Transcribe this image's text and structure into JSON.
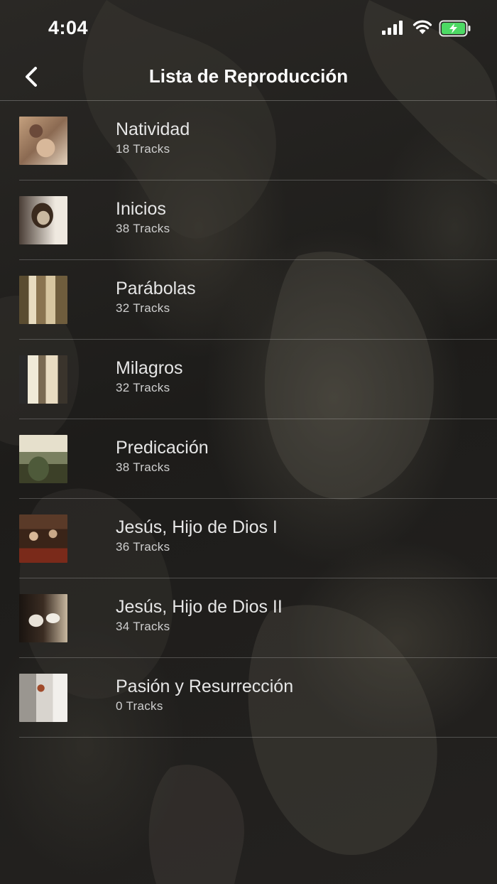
{
  "status_bar": {
    "time": "4:04",
    "icons": [
      "signal-icon",
      "wifi-icon",
      "battery-charging-icon"
    ],
    "battery_color": "#4cd964"
  },
  "nav": {
    "title": "Lista de Reproducción",
    "back_icon": "chevron-left-icon"
  },
  "playlists": [
    {
      "title": "Natividad",
      "tracks": "18 Tracks"
    },
    {
      "title": "Inicios",
      "tracks": "38 Tracks"
    },
    {
      "title": "Parábolas",
      "tracks": "32 Tracks"
    },
    {
      "title": "Milagros",
      "tracks": "32 Tracks"
    },
    {
      "title": "Predicación",
      "tracks": "38 Tracks"
    },
    {
      "title": "Jesús, Hijo de Dios I",
      "tracks": "36 Tracks"
    },
    {
      "title": "Jesús, Hijo de Dios II",
      "tracks": "34 Tracks"
    },
    {
      "title": "Pasión y Resurrección",
      "tracks": "0 Tracks"
    }
  ]
}
